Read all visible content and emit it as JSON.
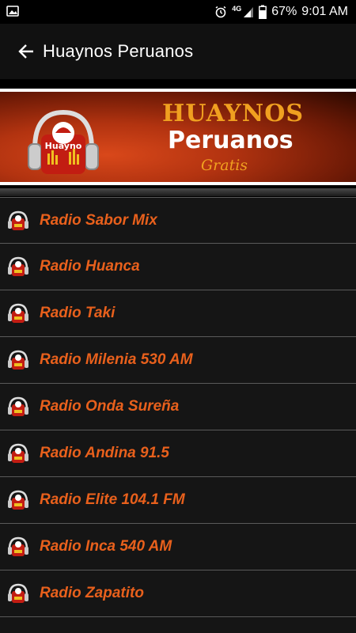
{
  "status_bar": {
    "network": "4G",
    "battery": "67%",
    "time": "9:01 AM"
  },
  "app_bar": {
    "title": "Huaynos Peruanos",
    "back_icon": "arrow-left-icon"
  },
  "banner": {
    "line1": "HUAYNOS",
    "line2": "Peruanos",
    "line3": "Gratis",
    "logo_text": "Huayno",
    "accent": "#f0a020",
    "background": "#b23310"
  },
  "stations": [
    {
      "label": "Radio Sabor Mix"
    },
    {
      "label": "Radio Huanca"
    },
    {
      "label": "Radio Taki"
    },
    {
      "label": "Radio Milenia 530 AM"
    },
    {
      "label": "Radio Onda Sureña"
    },
    {
      "label": "Radio Andina 91.5"
    },
    {
      "label": "Radio Elite 104.1 FM"
    },
    {
      "label": "Radio Inca 540 AM"
    },
    {
      "label": "Radio Zapatito"
    }
  ],
  "colors": {
    "station_text": "#e8601c",
    "list_bg": "#151515",
    "divider": "#5a5a5a"
  }
}
